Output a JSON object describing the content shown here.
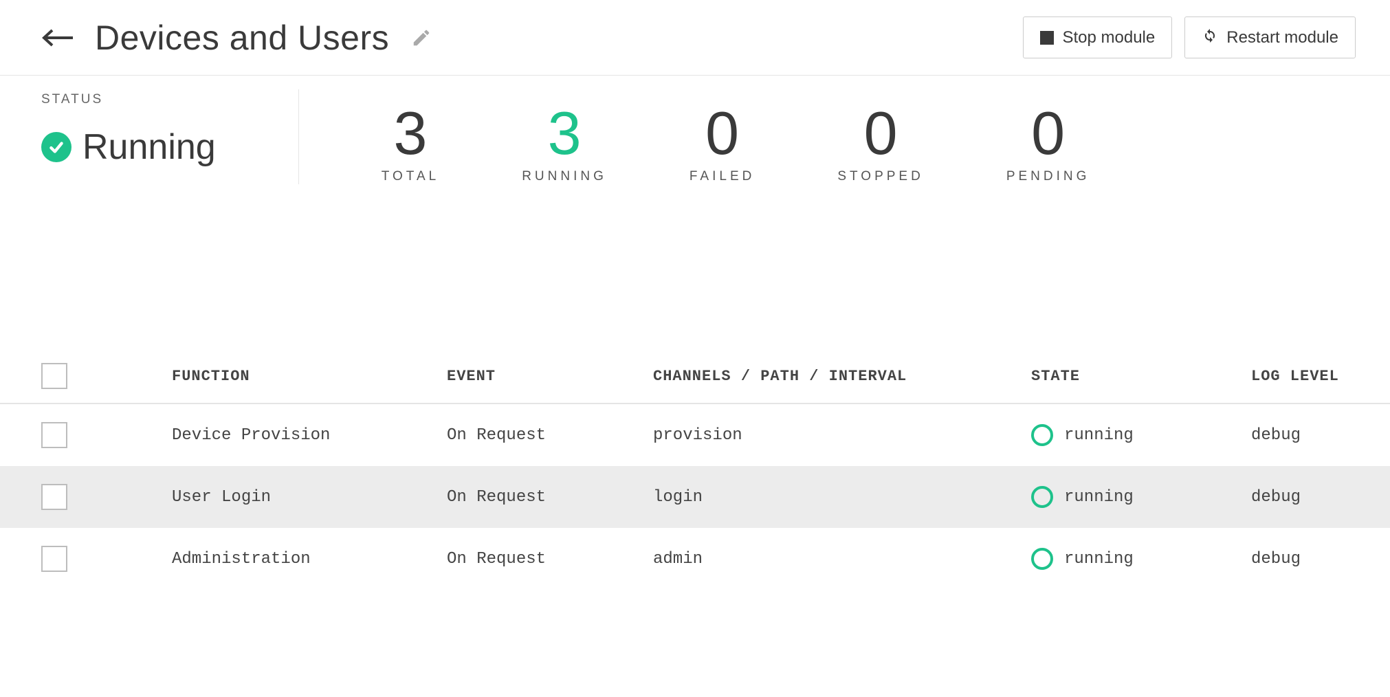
{
  "header": {
    "title": "Devices and Users",
    "stop_label": "Stop module",
    "restart_label": "Restart module"
  },
  "status": {
    "label": "STATUS",
    "value": "Running"
  },
  "metrics": {
    "total": {
      "value": "3",
      "label": "TOTAL"
    },
    "running": {
      "value": "3",
      "label": "RUNNING"
    },
    "failed": {
      "value": "0",
      "label": "FAILED"
    },
    "stopped": {
      "value": "0",
      "label": "STOPPED"
    },
    "pending": {
      "value": "0",
      "label": "PENDING"
    }
  },
  "table": {
    "headers": {
      "function": "FUNCTION",
      "event": "EVENT",
      "channels": "CHANNELS / PATH / INTERVAL",
      "state": "STATE",
      "log_level": "LOG LEVEL"
    },
    "rows": [
      {
        "function": "Device Provision",
        "event": "On Request",
        "channels": "provision",
        "state": "running",
        "log_level": "debug"
      },
      {
        "function": "User Login",
        "event": "On Request",
        "channels": "login",
        "state": "running",
        "log_level": "debug"
      },
      {
        "function": "Administration",
        "event": "On Request",
        "channels": "admin",
        "state": "running",
        "log_level": "debug"
      }
    ]
  }
}
